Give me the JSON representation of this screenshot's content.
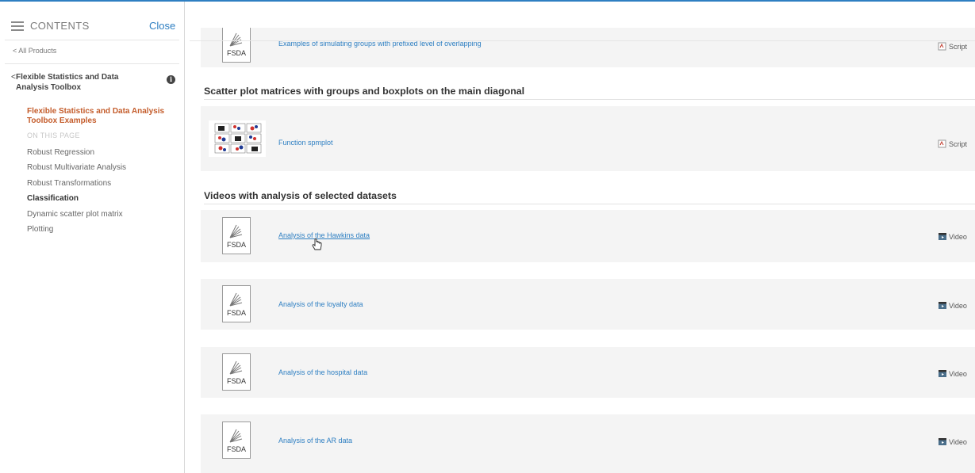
{
  "sidebar": {
    "header_label": "CONTENTS",
    "close_label": "Close",
    "all_products": "< All Products",
    "toolbox_chevron": "<",
    "toolbox_title": "Flexible Statistics and Data Analysis Toolbox",
    "current_page": "Flexible Statistics and Data Analysis Toolbox Examples",
    "on_this_page": "ON THIS PAGE",
    "toc": [
      {
        "label": "Robust Regression",
        "active": false
      },
      {
        "label": "Robust Multivariate Analysis",
        "active": false
      },
      {
        "label": "Robust Transformations",
        "active": false
      },
      {
        "label": "Classification",
        "active": true
      },
      {
        "label": "Dynamic scatter plot matrix",
        "active": false
      },
      {
        "label": "Plotting",
        "active": false
      }
    ]
  },
  "main": {
    "cards_top": [
      {
        "link": "Examples of simulating groups with prefixed level of overlapping",
        "type": "Script",
        "thumb_label": "FSDA"
      }
    ],
    "section_scatter": {
      "title": "Scatter plot matrices with groups and boxplots on the main diagonal",
      "card": {
        "link": "Function spmplot",
        "type": "Script"
      }
    },
    "section_videos": {
      "title": "Videos with analysis of selected datasets",
      "cards": [
        {
          "link": "Analysis of the Hawkins data",
          "type": "Video",
          "thumb_label": "FSDA",
          "hovered": true
        },
        {
          "link": "Analysis of the loyalty data",
          "type": "Video",
          "thumb_label": "FSDA"
        },
        {
          "link": "Analysis of the hospital data",
          "type": "Video",
          "thumb_label": "FSDA"
        },
        {
          "link": "Analysis of the AR data",
          "type": "Video",
          "thumb_label": "FSDA"
        }
      ]
    }
  },
  "colors": {
    "link": "#2e7fc2",
    "current_page": "#c45c2b",
    "card_bg": "#f4f4f4",
    "top_border": "#2e7fc2"
  },
  "icons": [
    "hamburger-icon",
    "info-icon",
    "fsda-logo",
    "script-icon",
    "video-icon",
    "hand-cursor-icon"
  ]
}
